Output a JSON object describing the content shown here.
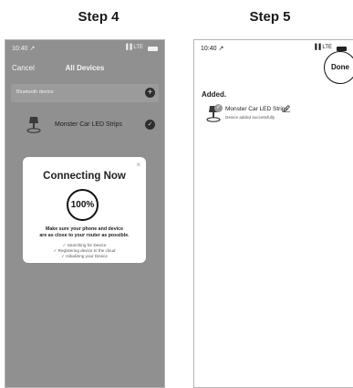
{
  "step4": {
    "heading": "Step 4",
    "status_bar": {
      "time": "10:40 ↗",
      "signal": "▐▐ LTE"
    },
    "nav": {
      "cancel": "Cancel",
      "title": "All Devices"
    },
    "bluetooth_section": {
      "label": "Bluetooth device",
      "add_icon": "plus-circle-icon"
    },
    "device": {
      "name": "Monster Car LED Strips",
      "icon": "lamp-icon",
      "check_icon": "check-circle-icon"
    },
    "modal": {
      "close": "×",
      "title": "Connecting Now",
      "progress_text": "100%",
      "progress": 1.0,
      "message_line1": "Make sure your phone and device",
      "message_line2": "are as close to your router as possible.",
      "steps": [
        "✓ Searching for Device",
        "✓ Registering device to the cloud",
        "✓ Initializing your Device"
      ]
    }
  },
  "step5": {
    "heading": "Step 5",
    "status_bar": {
      "time": "10:40 ↗",
      "signal": "▐▐ LTE"
    },
    "done_label": "Done",
    "added_heading": "Added.",
    "device": {
      "name": "Monster Car LED Strips",
      "status": "Device added successfully",
      "icon": "lamp-icon",
      "badge": "✓",
      "edit_icon": "pencil-icon"
    }
  },
  "colors": {
    "dimmed_background": "#909090",
    "modal_background": "#ffffff",
    "text_dark": "#1a1a1a"
  }
}
